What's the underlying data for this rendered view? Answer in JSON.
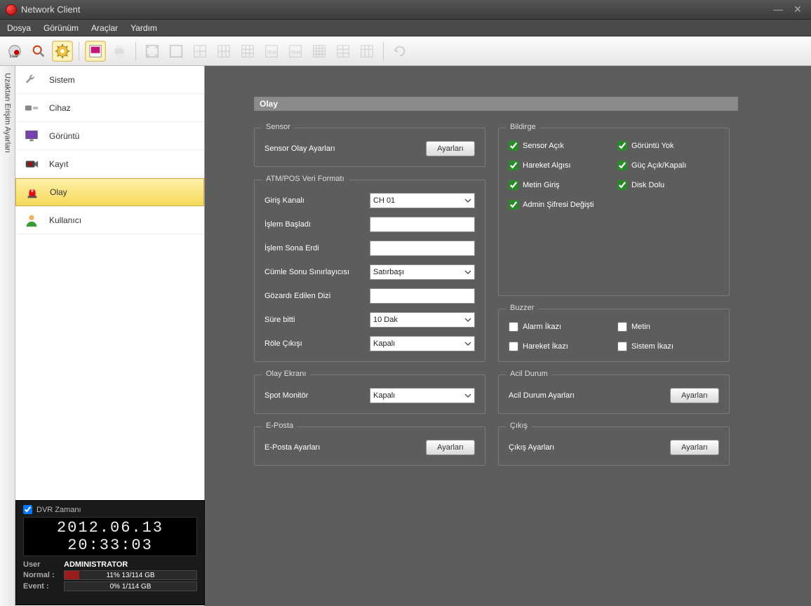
{
  "window": {
    "title": "Network Client"
  },
  "menu": {
    "file": "Dosya",
    "view": "Görünüm",
    "tools": "Araçlar",
    "help": "Yardım"
  },
  "vtab": "Uzaktan Erişim Ayarları",
  "sidebar": {
    "items": [
      {
        "label": "Sistem"
      },
      {
        "label": "Cihaz"
      },
      {
        "label": "Görüntü"
      },
      {
        "label": "Kayıt"
      },
      {
        "label": "Olay"
      },
      {
        "label": "Kullanıcı"
      }
    ]
  },
  "panel": {
    "title": "Olay"
  },
  "sensor": {
    "legend": "Sensor",
    "label": "Sensor Olay Ayarları",
    "btn": "Ayarları"
  },
  "atm": {
    "legend": "ATM/POS Veri Formatı",
    "input_channel_label": "Giriş Kanalı",
    "input_channel_value": "CH 01",
    "trans_start_label": "İşlem Başladı",
    "trans_start_value": "",
    "trans_end_label": "İşlem Sona Erdi",
    "trans_end_value": "",
    "line_delim_label": "Cümle Sonu Sınırlayıcısı",
    "line_delim_value": "Satırbaşı",
    "ignore_label": "Gözardı Edilen Dizi",
    "ignore_value": "",
    "timeout_label": "Süre bitti",
    "timeout_value": "10 Dak",
    "relay_label": "Röle Çıkışı",
    "relay_value": "Kapalı"
  },
  "notify": {
    "legend": "Bildirge",
    "sensor_on": "Sensor Açık",
    "video_loss": "Görüntü Yok",
    "motion": "Hareket Algısı",
    "power": "Güç Açık/Kapalı",
    "text_in": "Metin Giriş",
    "disk_full": "Disk Dolu",
    "admin_pw": "Admin Şifresi Değişti"
  },
  "buzzer": {
    "legend": "Buzzer",
    "alarm": "Alarm İkazı",
    "text": "Metin",
    "motion": "Hareket İkazı",
    "system": "Sistem İkazı"
  },
  "eventscreen": {
    "legend": "Olay Ekranı",
    "spot_label": "Spot Monitör",
    "spot_value": "Kapalı"
  },
  "emergency": {
    "legend": "Acil Durum",
    "label": "Acil Durum Ayarları",
    "btn": "Ayarları"
  },
  "email": {
    "legend": "E-Posta",
    "label": "E-Posta Ayarları",
    "btn": "Ayarları"
  },
  "output": {
    "legend": "Çıkış",
    "label": "Çıkış Ayarları",
    "btn": "Ayarları"
  },
  "status": {
    "dvr_time_label": "DVR Zamanı",
    "clock": "2012.06.13 20:33:03",
    "user_label": "User",
    "user_value": "ADMINISTRATOR",
    "normal_label": "Normal :",
    "normal_pct": 11,
    "normal_text": "11% 13/114 GB",
    "event_label": "Event   :",
    "event_pct": 0,
    "event_text": "0% 1/114 GB"
  }
}
